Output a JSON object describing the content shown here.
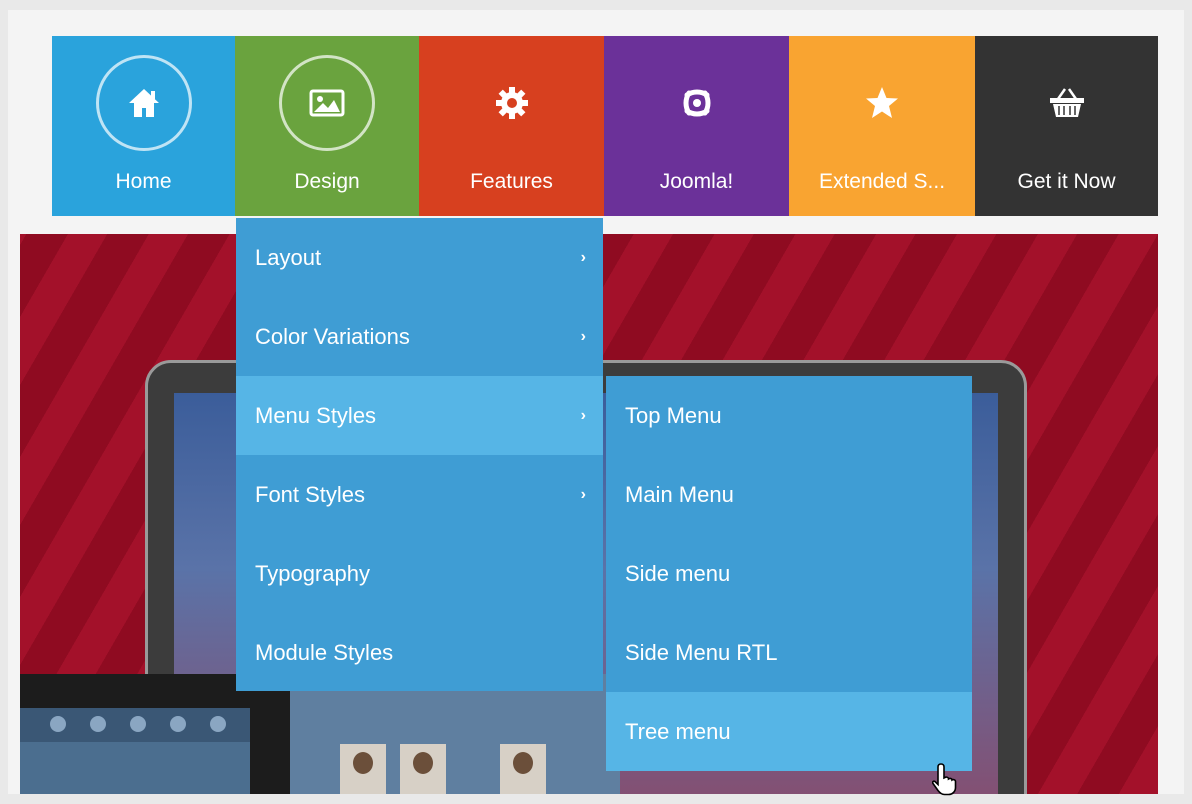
{
  "nav": {
    "items": [
      {
        "label": "Home",
        "icon": "home-icon",
        "color": "#2aa3dc",
        "ring": true
      },
      {
        "label": "Design",
        "icon": "image-icon",
        "color": "#6aa33e",
        "ring": true
      },
      {
        "label": "Features",
        "icon": "gear-icon",
        "color": "#d7401f",
        "ring": false
      },
      {
        "label": "Joomla!",
        "icon": "joomla-icon",
        "color": "#6b3199",
        "ring": false
      },
      {
        "label": "Extended S...",
        "icon": "star-icon",
        "color": "#f9a431",
        "ring": false
      },
      {
        "label": "Get it Now",
        "icon": "basket-icon",
        "color": "#333333",
        "ring": false
      }
    ]
  },
  "design_menu": {
    "items": [
      {
        "label": "Layout",
        "has_submenu": true
      },
      {
        "label": "Color Variations",
        "has_submenu": true
      },
      {
        "label": "Menu Styles",
        "has_submenu": true
      },
      {
        "label": "Font Styles",
        "has_submenu": true
      },
      {
        "label": "Typography",
        "has_submenu": false
      },
      {
        "label": "Module Styles",
        "has_submenu": false
      }
    ]
  },
  "menu_styles_submenu": {
    "items": [
      {
        "label": "Top Menu"
      },
      {
        "label": "Main Menu"
      },
      {
        "label": "Side menu"
      },
      {
        "label": "Side Menu RTL"
      },
      {
        "label": "Tree menu"
      }
    ]
  },
  "colors": {
    "dropdown_bg": "#3f9dd4",
    "dropdown_active": "#56b5e6",
    "hero_red": "#a3112a"
  }
}
